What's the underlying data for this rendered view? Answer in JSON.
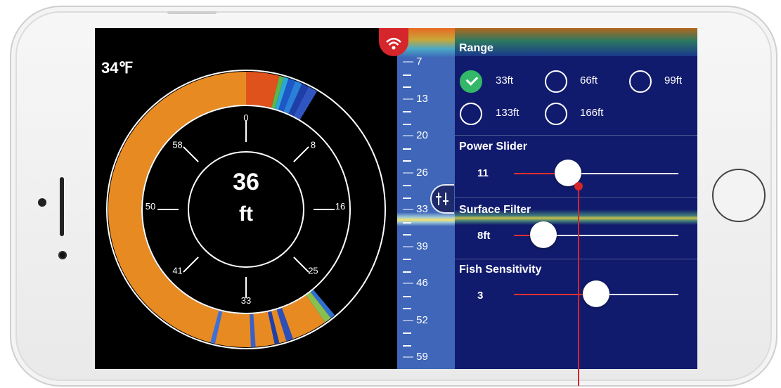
{
  "gauge": {
    "temperature": "34℉",
    "depth_value": "36",
    "depth_unit": "ft",
    "dial_labels": [
      "0",
      "8",
      "16",
      "25",
      "33",
      "41",
      "50",
      "58"
    ]
  },
  "ruler": {
    "labels": [
      "7",
      "13",
      "20",
      "26",
      "33",
      "39",
      "46",
      "52",
      "59"
    ]
  },
  "range": {
    "title": "Range",
    "options": [
      {
        "label": "33ft",
        "selected": true
      },
      {
        "label": "66ft",
        "selected": false
      },
      {
        "label": "99ft",
        "selected": false
      },
      {
        "label": "133ft",
        "selected": false
      },
      {
        "label": "166ft",
        "selected": false
      }
    ]
  },
  "sliders": [
    {
      "title": "Power Slider",
      "value": "11",
      "level": 0.33
    },
    {
      "title": "Surface Filter",
      "value": "8ft",
      "level": 0.18
    },
    {
      "title": "Fish Sensitivity",
      "value": "3",
      "level": 0.5
    }
  ],
  "colors": {
    "accent_red": "#d4262b",
    "panel_blue": "#111b6d",
    "ruler_blue": "#3f66b8",
    "check_green": "#33b86a",
    "signal_orange": "#e88a22"
  },
  "icons": {
    "wifi": "wifi-icon",
    "settings_handle": "sliders-icon",
    "check": "checkmark-icon"
  }
}
